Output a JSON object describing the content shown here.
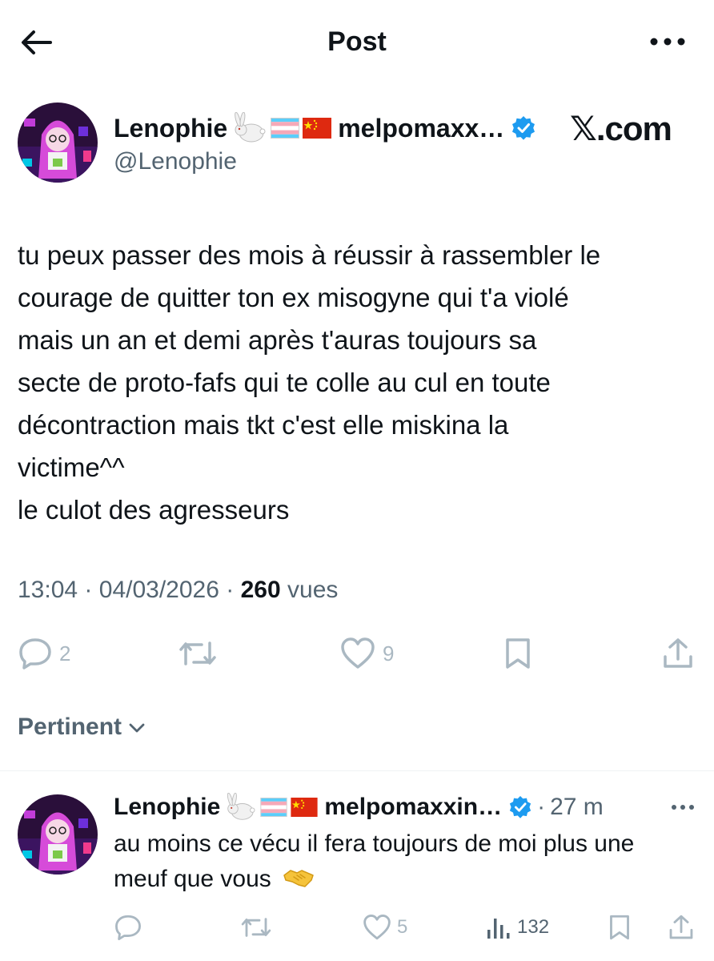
{
  "header": {
    "title": "Post"
  },
  "post": {
    "display_name": "Lenophie",
    "display_name_suffix": "melpomaxx…",
    "handle": "@Lenophie",
    "badge_text": "𝕏.com",
    "text": "tu peux passer des mois à réussir à rassembler le\ncourage de quitter ton ex misogyne qui t'a violé\nmais un an et demi après t'auras toujours sa\nsecte de proto-fafs qui te colle au cul en toute\ndécontraction mais tkt c'est elle miskina la\nvictime^^\nle culot des agresseurs",
    "time": "13:04",
    "separator": "·",
    "date": "04/03/2026",
    "views_count": "260",
    "views_label": "vues",
    "replies": "2",
    "likes": "9",
    "icons": [
      "reply-icon",
      "repost-icon",
      "like-icon",
      "bookmark-icon",
      "share-icon"
    ]
  },
  "sort": {
    "label": "Pertinent"
  },
  "reply": {
    "display_name": "Lenophie",
    "display_name_suffix": "melpomaxxin…",
    "separator": "·",
    "time": "27 m",
    "text": "au moins ce vécu il fera toujours de moi plus une meuf que vous",
    "likes": "5",
    "views": "132"
  },
  "colors": {
    "verified": "#1d9bf0",
    "text": "#0f1419",
    "secondary": "#536471",
    "icon": "#aab8c2"
  }
}
